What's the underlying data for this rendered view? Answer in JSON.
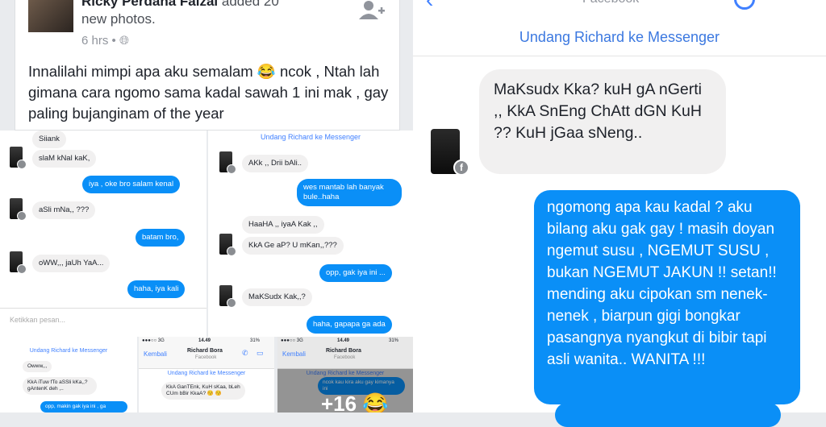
{
  "post": {
    "author": "Ricky Perdana Faizal",
    "action": "added 20",
    "action2": "new photos.",
    "time": "6 hrs",
    "text": "Innalilahi mimpi apa aku semalam 😂 ncok , Ntah lah gimana cara ngomo sama kadal sawah 1 ini mak , gay paling bujanginam of the year"
  },
  "chat1": {
    "messages": [
      {
        "side": "l",
        "text": "Siiank"
      },
      {
        "side": "l",
        "text": "slaM kNal kaK,"
      },
      {
        "side": "r",
        "text": "iya , oke bro salam kenal"
      },
      {
        "side": "l",
        "text": "aSli mNa,, ???"
      },
      {
        "side": "r",
        "text": "batam bro,"
      },
      {
        "side": "l",
        "text": "oWW,,, jaUh YaA..."
      },
      {
        "side": "r",
        "text": "haha, iya kali"
      }
    ],
    "input_placeholder": "Ketikkan pesan..."
  },
  "chat2": {
    "invite": "Undang Richard ke Messenger",
    "messages": [
      {
        "side": "l",
        "text": "AKk ,, Drii bAli.."
      },
      {
        "side": "r",
        "text": "wes mantab lah banyak bule..haha"
      },
      {
        "side": "l",
        "text": "HaaHA ,, iyaA Kak ,,"
      },
      {
        "side": "l",
        "text": "KkA Ge aP? U mKan,,???"
      },
      {
        "side": "r",
        "text": "opp, gak iya ini ..."
      },
      {
        "side": "l",
        "text": "MaKSudx Kak,,?"
      },
      {
        "side": "r",
        "text": "haha, gapapa ga ada"
      }
    ]
  },
  "thumb1": {
    "invite": "Undang Richard ke Messenger",
    "messages": [
      {
        "side": "l",
        "text": "Owww,,,"
      },
      {
        "side": "l",
        "text": "KkA iTuw fTo aSSli kKa,,? gAntenK deh ,.."
      },
      {
        "side": "r",
        "text": "opp, makin gak iya ini , ga"
      }
    ]
  },
  "thumb2": {
    "status_time": "14.49",
    "carrier": "●●●○○ 3G",
    "battery": "31%",
    "back": "Kembali",
    "contact": "Richard Bora",
    "sub": "Facebook",
    "invite": "Undang Richard ke Messenger",
    "messages": [
      {
        "side": "l",
        "text": "KkA GanTEnk, KuH sKaa, bLeh CUm bBir KkaA? 😚 😚"
      }
    ]
  },
  "thumb3": {
    "status_time": "14.49",
    "carrier": "●●●○○ 3G",
    "battery": "31%",
    "back": "Kembali",
    "contact": "Richard Bora",
    "sub": "Facebook",
    "invite": "Undang Richard ke Messenger",
    "messages": [
      {
        "side": "r",
        "text": "ncok kau kira aku gay kimanya ini"
      }
    ],
    "more_count": "+16 😂"
  },
  "big_chat": {
    "header_label": "Facebook",
    "invite": "Undang Richard ke Messenger",
    "received": "MaKsudx Kka? kuH gA nGerti ,, KkA SnEng ChAtt dGN KuH ?? KuH jGaa sNeng..",
    "sent": "ngomong apa kau kadal ? aku bilang aku gak gay ! masih doyan ngemut susu , NGEMUT SUSU , bukan NGEMUT JAKUN !! setan!! mending aku cipokan sm nenek-nenek , biarpun gigi bongkar pasangnya nyangkut di bibir tapi asli wanita.. WANITA !!!"
  },
  "colors": {
    "accent": "#0a8ff7",
    "invite": "#4080ff",
    "bubble_gray": "#f1f0f0"
  }
}
